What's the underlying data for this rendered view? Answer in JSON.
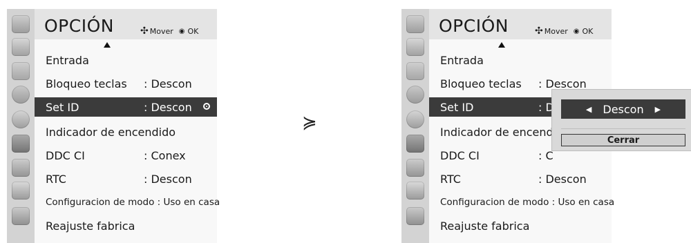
{
  "arrow_symbol": "≽",
  "screens": [
    {
      "title": "OPCIÓN",
      "legend": {
        "move_icon": "✣",
        "move_label": "Mover",
        "ok_icon": "◉",
        "ok_label": "OK"
      },
      "menu": [
        {
          "label": "Entrada",
          "value": ""
        },
        {
          "label": "Bloqueo teclas",
          "value": ": Descon"
        },
        {
          "label": "Set ID",
          "value": ": Descon",
          "selected": true
        },
        {
          "label": "Indicador de encendido",
          "value": ""
        },
        {
          "label": "DDC CI",
          "value": ": Conex"
        },
        {
          "label": "RTC",
          "value": ": Descon"
        },
        {
          "label": "Configuracion de modo : Uso en casa",
          "value": ""
        },
        {
          "label": "Reajuste fabrica",
          "value": ""
        }
      ]
    },
    {
      "title": "OPCIÓN",
      "legend": {
        "move_icon": "✣",
        "move_label": "Mover",
        "ok_icon": "◉",
        "ok_label": "OK"
      },
      "menu": [
        {
          "label": "Entrada",
          "value": ""
        },
        {
          "label": "Bloqueo teclas",
          "value": ": Descon"
        },
        {
          "label": "Set ID",
          "value": ": D",
          "selected": true
        },
        {
          "label": "Indicador de encendi",
          "value": ""
        },
        {
          "label": "DDC CI",
          "value": ": C"
        },
        {
          "label": "RTC",
          "value": ": Descon"
        },
        {
          "label": "Configuracion de modo : Uso en casa",
          "value": ""
        },
        {
          "label": "Reajuste fabrica",
          "value": ""
        }
      ],
      "popup": {
        "left_arrow": "◀",
        "value": "Descon",
        "right_arrow": "▶",
        "close_label": "Cerrar"
      }
    }
  ],
  "icons": [
    "setup-icon",
    "picture-icon",
    "display-icon",
    "audio-icon",
    "time-icon",
    "option-icon",
    "lock-icon",
    "input-icon",
    "support-icon"
  ]
}
